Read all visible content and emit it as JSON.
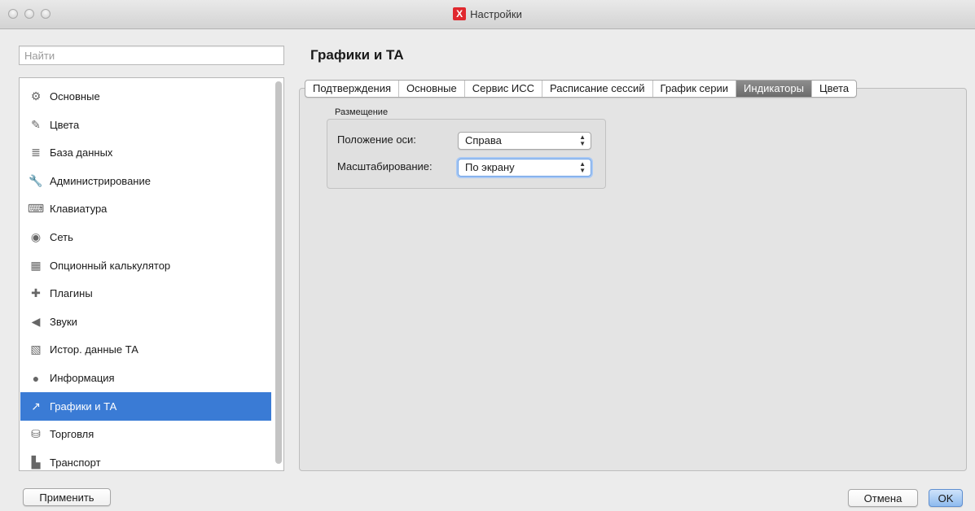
{
  "window": {
    "title": "Настройки",
    "logo": "X"
  },
  "search": {
    "placeholder": "Найти",
    "value": ""
  },
  "sidebar": {
    "selected_index": 11,
    "items": [
      {
        "label": "Основные",
        "icon": "gear-icon",
        "glyph": "⚙"
      },
      {
        "label": "Цвета",
        "icon": "brush-icon",
        "glyph": "✎"
      },
      {
        "label": "База данных",
        "icon": "database-icon",
        "glyph": "≣"
      },
      {
        "label": "Администрирование",
        "icon": "wrench-icon",
        "glyph": "🔧"
      },
      {
        "label": "Клавиатура",
        "icon": "keyboard-icon",
        "glyph": "⌨"
      },
      {
        "label": "Сеть",
        "icon": "network-icon",
        "glyph": "◉"
      },
      {
        "label": "Опционный калькулятор",
        "icon": "calculator-icon",
        "glyph": "▦"
      },
      {
        "label": "Плагины",
        "icon": "puzzle-icon",
        "glyph": "✚"
      },
      {
        "label": "Звуки",
        "icon": "speaker-icon",
        "glyph": "◀"
      },
      {
        "label": "Истор. данные ТА",
        "icon": "history-chart-icon",
        "glyph": "▧"
      },
      {
        "label": "Информация",
        "icon": "info-icon",
        "glyph": "●"
      },
      {
        "label": "Графики и ТА",
        "icon": "chart-icon",
        "glyph": "↗"
      },
      {
        "label": "Торговля",
        "icon": "coins-icon",
        "glyph": "⛁"
      },
      {
        "label": "Транспорт",
        "icon": "transport-icon",
        "glyph": "▙"
      }
    ]
  },
  "main": {
    "title": "Графики и ТА",
    "tabs": [
      {
        "label": "Подтверждения",
        "active": false
      },
      {
        "label": "Основные",
        "active": false
      },
      {
        "label": "Сервис ИСС",
        "active": false
      },
      {
        "label": "Расписание сессий",
        "active": false
      },
      {
        "label": "График серии",
        "active": false
      },
      {
        "label": "Индикаторы",
        "active": true
      },
      {
        "label": "Цвета",
        "active": false
      }
    ],
    "group": {
      "title": "Размещение",
      "axis_label": "Положение оси:",
      "axis_value": "Справа",
      "scale_label": "Масштабирование:",
      "scale_value": "По экрану"
    }
  },
  "footer": {
    "apply_label": "Применить",
    "cancel_label": "Отмена",
    "ok_label": "OK"
  },
  "colors": {
    "selection": "#3a7bd5",
    "brand": "#e0282e"
  }
}
